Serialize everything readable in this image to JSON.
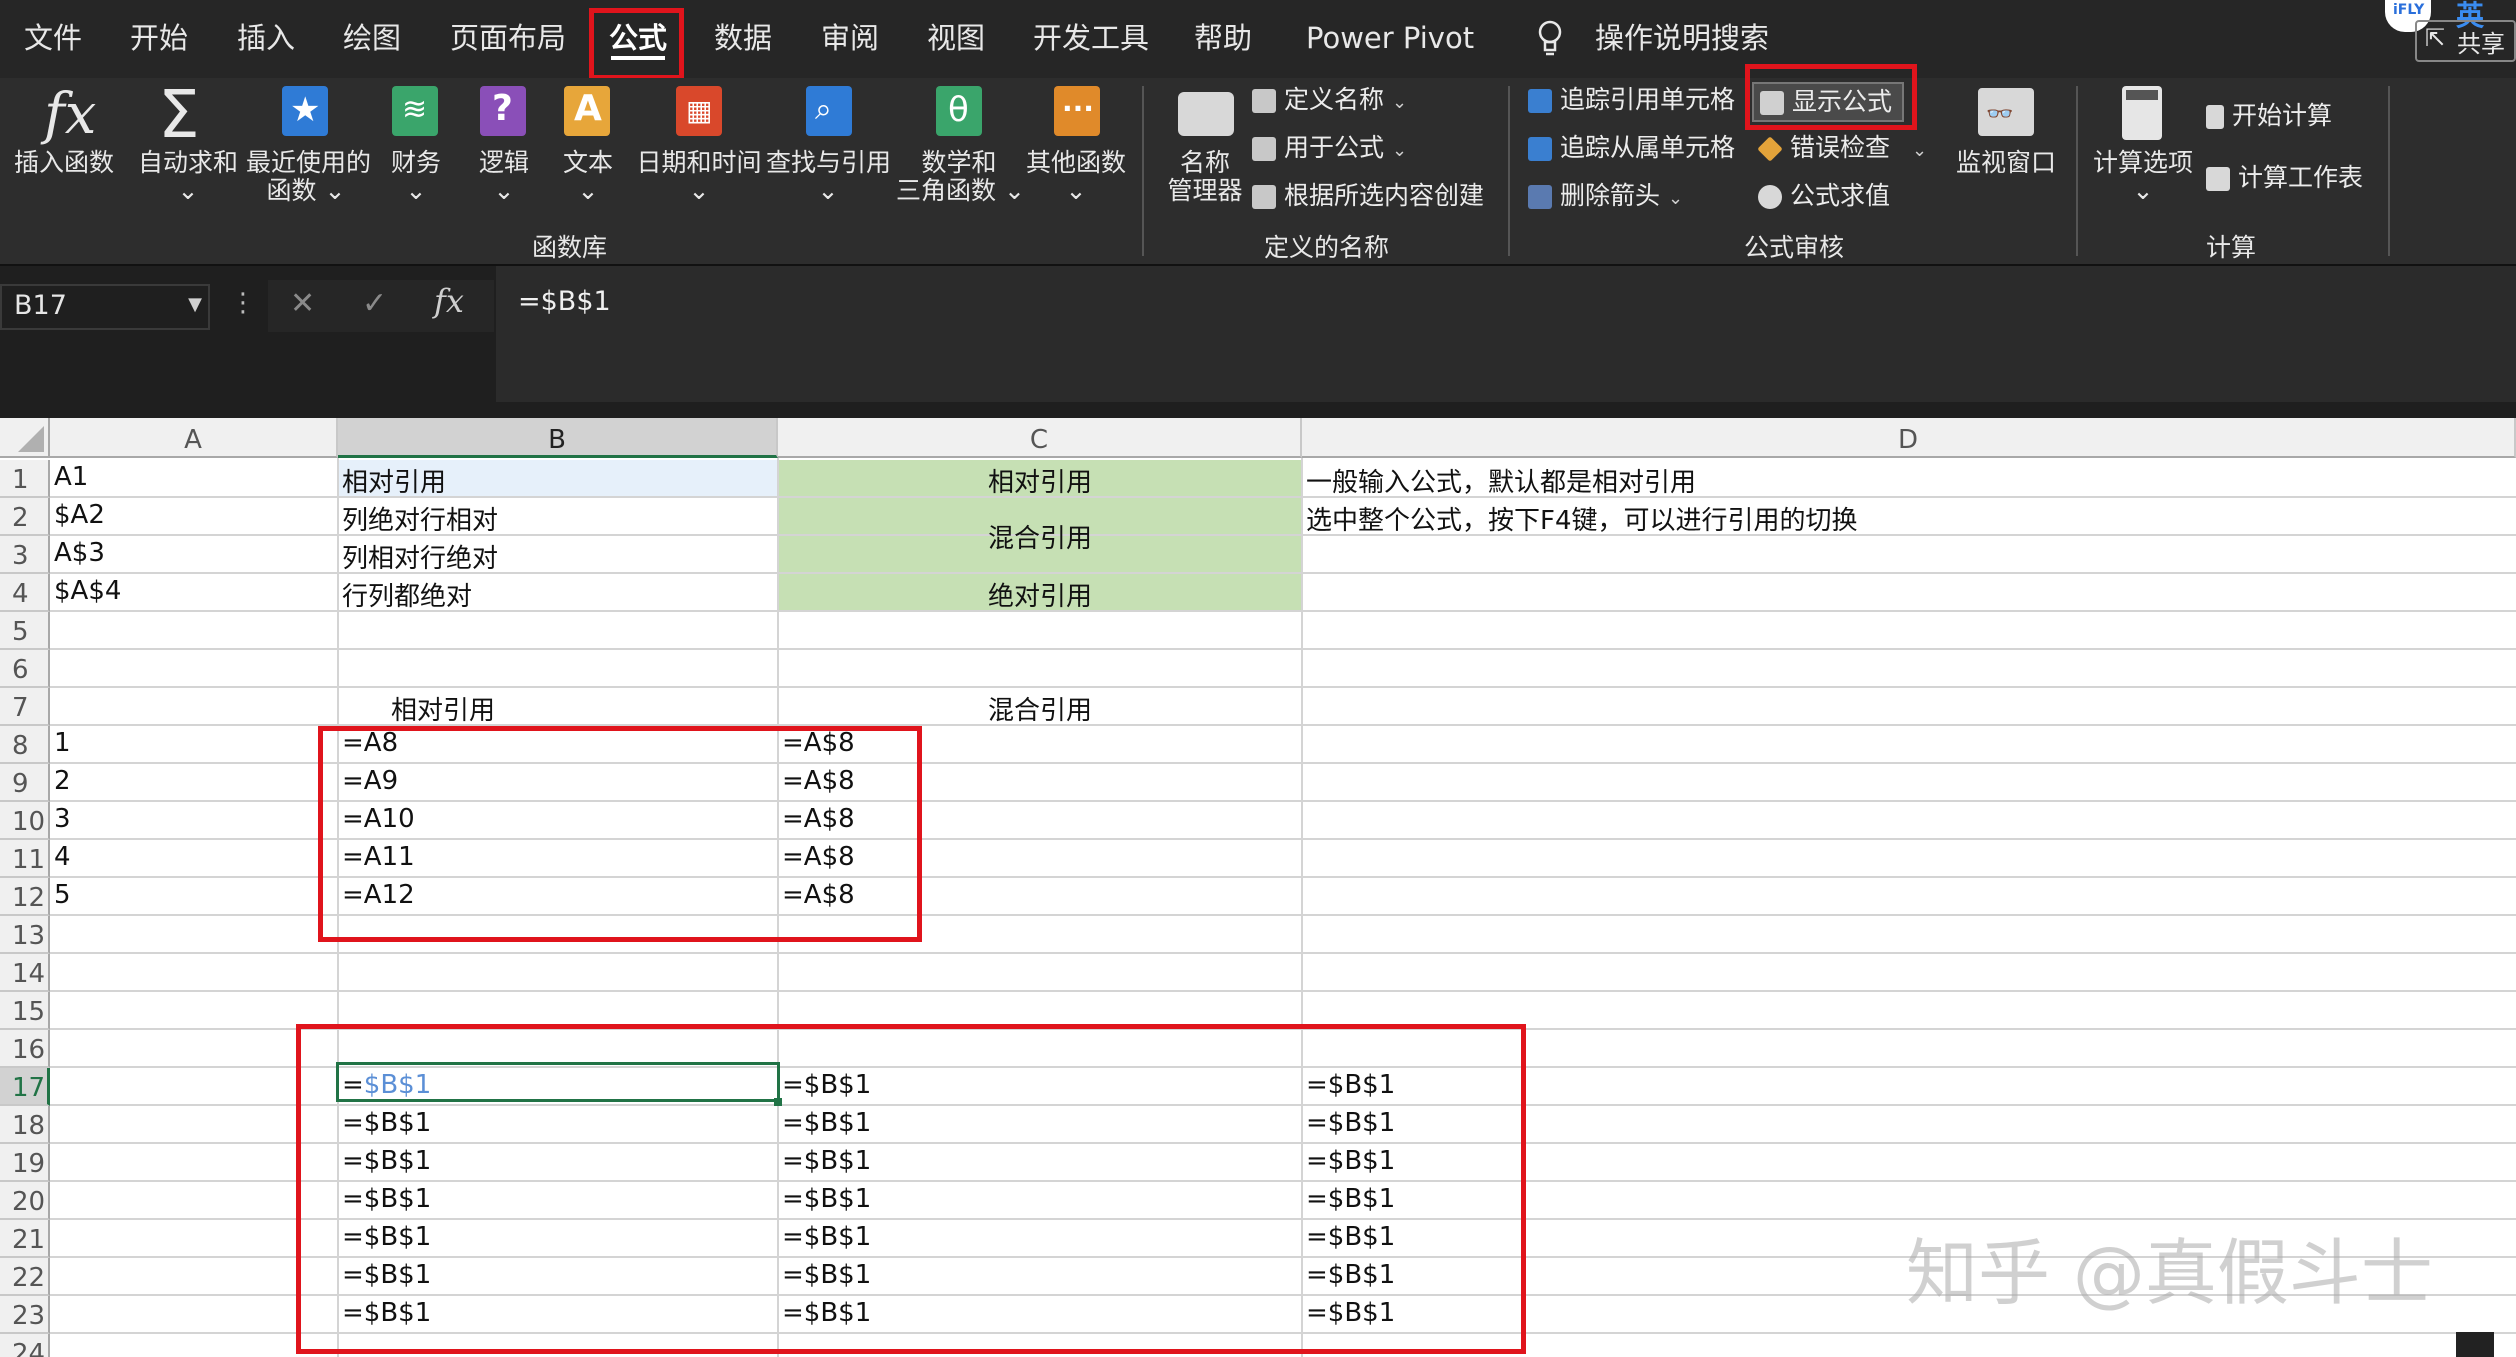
{
  "tabs": [
    "文件",
    "开始",
    "插入",
    "绘图",
    "页面布局",
    "公式",
    "数据",
    "审阅",
    "视图",
    "开发工具",
    "帮助",
    "Power Pivot"
  ],
  "active_tab": "公式",
  "search": {
    "label": "操作说明搜索"
  },
  "topright": {
    "ime": "英",
    "share": "共享"
  },
  "ribbon": {
    "function_library": {
      "group_name": "函数库",
      "buttons": [
        {
          "label1": "插入函数",
          "label2": ""
        },
        {
          "label1": "自动求和",
          "label2": "⌄"
        },
        {
          "label1": "最近使用的",
          "label2": "函数 ⌄"
        },
        {
          "label1": "财务",
          "label2": "⌄"
        },
        {
          "label1": "逻辑",
          "label2": "⌄"
        },
        {
          "label1": "文本",
          "label2": "⌄"
        },
        {
          "label1": "日期和时间",
          "label2": "⌄"
        },
        {
          "label1": "查找与引用",
          "label2": "⌄"
        },
        {
          "label1": "数学和",
          "label2": "三角函数 ⌄"
        },
        {
          "label1": "其他函数",
          "label2": "⌄"
        }
      ]
    },
    "defined_names": {
      "group_name": "定义的名称",
      "name_manager": {
        "label1": "名称",
        "label2": "管理器"
      },
      "define_name": "定义名称",
      "use_in_formula": "用于公式",
      "create_from_selection": "根据所选内容创建"
    },
    "formula_auditing": {
      "group_name": "公式审核",
      "trace_precedents": "追踪引用单元格",
      "trace_dependents": "追踪从属单元格",
      "remove_arrows": "删除箭头",
      "show_formulas": "显示公式",
      "error_checking": "错误检查",
      "evaluate_formula": "公式求值",
      "watch_window": "监视窗口"
    },
    "calculation": {
      "group_name": "计算",
      "calc_options": "计算选项",
      "calc_now": "开始计算",
      "calc_sheet": "计算工作表"
    }
  },
  "formula_bar": {
    "name_box": "B17",
    "formula": "=$B$1",
    "fx": "fx"
  },
  "columns": [
    "A",
    "B",
    "C",
    "D"
  ],
  "rows": [
    "1",
    "2",
    "3",
    "4",
    "5",
    "6",
    "7",
    "8",
    "9",
    "10",
    "11",
    "12",
    "13",
    "14",
    "15",
    "16",
    "17",
    "18",
    "19",
    "20",
    "21",
    "22",
    "23",
    "24"
  ],
  "cells": {
    "A1": "A1",
    "B1": "相对引用",
    "C1": "相对引用",
    "D1": "一般输入公式，默认都是相对引用",
    "A2": "$A2",
    "B2": "列绝对行相对",
    "C2_3": "混合引用",
    "D2": "选中整个公式，按下F4键，可以进行引用的切换",
    "A3": "A$3",
    "B3": "列相对行绝对",
    "A4": "$A$4",
    "B4": "行列都绝对",
    "C4": "绝对引用",
    "B7": "相对引用",
    "C7": "混合引用",
    "A8": "1",
    "B8": "=A8",
    "C8": "=A$8",
    "A9": "2",
    "B9": "=A9",
    "C9": "=A$8",
    "A10": "3",
    "B10": "=A10",
    "C10": "=A$8",
    "A11": "4",
    "B11": "=A11",
    "C11": "=A$8",
    "A12": "5",
    "B12": "=A12",
    "C12": "=A$8",
    "B17_eq": "=",
    "B17_ref": "$B$1",
    "C17": "=$B$1",
    "D17": "=$B$1",
    "B18": "=$B$1",
    "C18": "=$B$1",
    "D18": "=$B$1",
    "B19": "=$B$1",
    "C19": "=$B$1",
    "D19": "=$B$1",
    "B20": "=$B$1",
    "C20": "=$B$1",
    "D20": "=$B$1",
    "B21": "=$B$1",
    "C21": "=$B$1",
    "D21": "=$B$1",
    "B22": "=$B$1",
    "C22": "=$B$1",
    "D22": "=$B$1",
    "B23": "=$B$1",
    "C23": "=$B$1",
    "D23": "=$B$1"
  },
  "watermark": "知乎 @真假斗士",
  "colors": {
    "green_fill": "#c6e0b4",
    "highlight_red": "#e0141c",
    "select_green": "#217346"
  }
}
